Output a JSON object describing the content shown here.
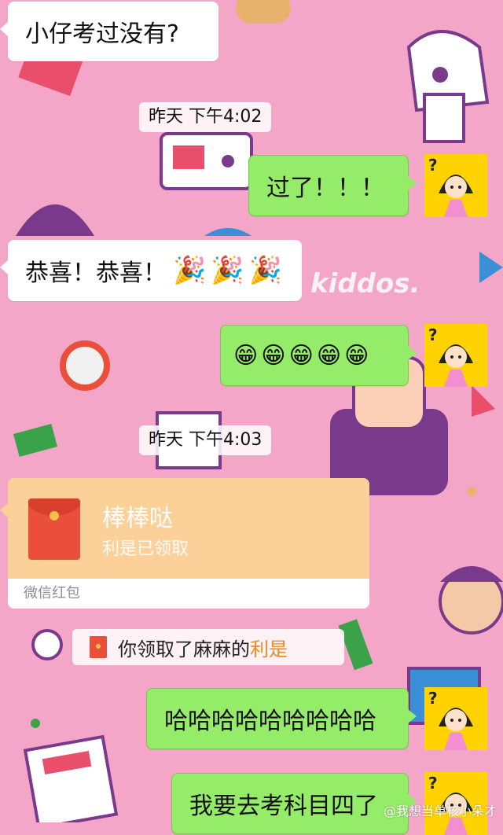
{
  "messages": {
    "m1": "小仔考过没有?",
    "m2": "过了！！！",
    "m3": "恭喜！恭喜！",
    "m3_emoji": [
      "🎉",
      "🎉",
      "🎉"
    ],
    "m4_emoji": [
      "😁",
      "😁",
      "😁",
      "😁",
      "😁"
    ],
    "m5": "哈哈哈哈哈哈哈哈哈",
    "m6": "我要去考科目四了"
  },
  "timestamps": {
    "t1": "昨天 下午4:02",
    "t2": "昨天 下午4:03"
  },
  "red_packet": {
    "title": "棒棒哒",
    "status": "利是已领取",
    "footer": "微信红包"
  },
  "system_notice": {
    "text": "你领取了麻麻的",
    "highlight": "利是"
  },
  "watermark": "@我想当单核小朵才",
  "colors": {
    "background": "#f3a6c8",
    "outgoing_bubble": "#95ec69",
    "incoming_bubble": "#ffffff",
    "red_packet": "#fcd099",
    "avatar_bg": "#ffd200",
    "highlight": "#f28a1a"
  },
  "avatar": {
    "icon": "cartoon-girl-avatar",
    "mark": "?"
  }
}
